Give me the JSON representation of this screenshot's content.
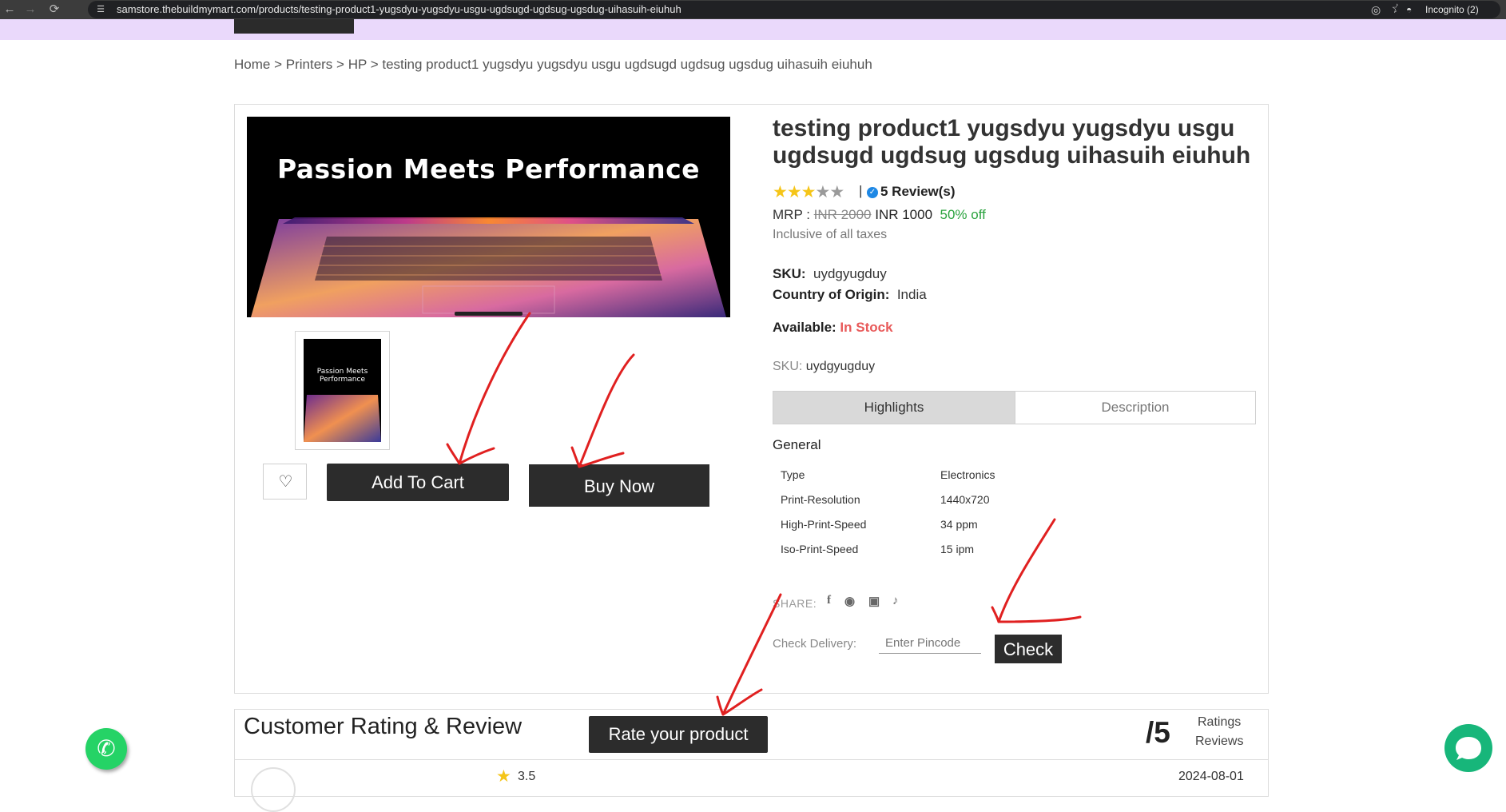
{
  "browser": {
    "url": "samstore.thebuildmymart.com/products/testing-product1-yugsdyu-yugsdyu-usgu-ugdsugd-ugdsug-ugsdug-uihasuih-eiuhuh",
    "incognito_label": "Incognito (2)"
  },
  "breadcrumb": {
    "items": [
      "Home",
      "Printers",
      "HP",
      "testing product1 yugsdyu yugsdyu usgu ugdsugd ugdsug ugsdug uihasuih eiuhuh"
    ],
    "separator": " > "
  },
  "product": {
    "image_text": "Passion Meets Performance",
    "title": "testing product1 yugsdyu yugsdyu usgu ugdsugd ugdsug ugsdug uihasuih eiuhuh",
    "rating_value": 3,
    "rating_max": 5,
    "reviews_link": "5 Review(s)",
    "mrp_label": "MRP :",
    "mrp_old": "INR 2000",
    "price": "INR 1000",
    "discount": "50% off",
    "tax_note": "Inclusive of all taxes",
    "sku_label": "SKU:",
    "sku": "uydgyugduy",
    "origin_label": "Country of Origin:",
    "origin": "India",
    "availability_label": "Available:",
    "availability": "In Stock",
    "sku2_label": "SKU:",
    "sku2": "uydgyugduy"
  },
  "actions": {
    "add_to_cart": "Add To Cart",
    "buy_now": "Buy Now"
  },
  "tabs": {
    "highlights": "Highlights",
    "description": "Description"
  },
  "specs": {
    "heading": "General",
    "rows": [
      {
        "label": "Type",
        "value": "Electronics"
      },
      {
        "label": "Print-Resolution",
        "value": "1440x720"
      },
      {
        "label": "High-Print-Speed",
        "value": "34 ppm"
      },
      {
        "label": "Iso-Print-Speed",
        "value": "15 ipm"
      }
    ]
  },
  "share": {
    "label": "SHARE:",
    "icons": [
      "facebook-icon",
      "whatsapp-icon",
      "instagram-icon",
      "twitter-icon"
    ]
  },
  "delivery": {
    "label": "Check Delivery:",
    "placeholder": "Enter Pincode",
    "check_button": "Check"
  },
  "reviews": {
    "title": "Customer Rating & Review",
    "rate_button": "Rate your product",
    "out_of": "/5",
    "ratings_label": "Ratings",
    "reviews_label": "Reviews",
    "first_review": {
      "score": "3.5",
      "date": "2024-08-01"
    }
  },
  "colors": {
    "header_strip": "#ead9fb",
    "button_dark": "#2c2c2c",
    "in_stock": "#e85a5a",
    "discount": "#2ba33f",
    "star": "#f5c518",
    "annotation": "#e02020",
    "whatsapp": "#25d366",
    "chat": "#17b67a"
  }
}
